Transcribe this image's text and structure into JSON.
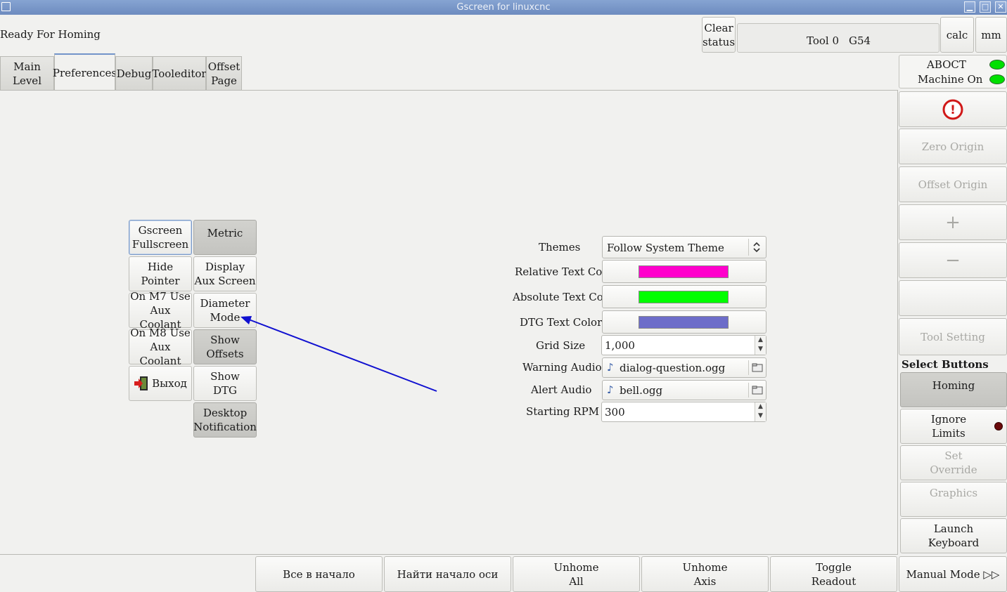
{
  "window": {
    "title": "Gscreen for linuxcnc",
    "min": "▁",
    "max": "□",
    "close": "✕"
  },
  "status": {
    "message": "Ready For Homing",
    "clear_label": "Clear\nstatus",
    "tool": "Tool 0",
    "coord": "G54",
    "calc_label": "calc",
    "units_label": "mm",
    "abort_label": "ABOCT",
    "machine_on_label": "Machine On",
    "led_color": "#00e000"
  },
  "tabs": [
    "Main Level",
    "Preferences",
    "Debug",
    "Tooleditor",
    "Offset\nPage"
  ],
  "prefs_buttons": {
    "fullscreen": "Gscreen\nFullscreen",
    "metric": "Metric",
    "hide_pointer": "Hide Pointer",
    "display_aux": "Display\nAux Screen",
    "m7": "On M7 Use\nAux Coolant",
    "diameter": "Diameter\nMode",
    "m8": "On M8 Use\nAux Coolant",
    "show_offsets": "Show\nOffsets",
    "exit": "Выход",
    "show_dtg": "Show\nDTG",
    "desktop_notification": "Desktop\nNotification"
  },
  "settings": {
    "themes_label": "Themes",
    "theme_value": "Follow System Theme",
    "rel_color_label": "Relative Text Color",
    "rel_color": "#ff00cc",
    "abs_color_label": "Absolute Text Color",
    "abs_color": "#00ff00",
    "dtg_color_label": "DTG Text Color",
    "dtg_color": "#6d6dc9",
    "grid_label": "Grid Size",
    "grid_value": "1,000",
    "warning_label": "Warning Audio",
    "warning_file": "dialog-question.ogg",
    "alert_label": "Alert Audio",
    "alert_file": "bell.ogg",
    "rpm_label": "Starting RPM",
    "rpm_value": "300"
  },
  "right_panel": {
    "estop_icon": "!",
    "zero_origin": "Zero Origin",
    "offset_origin": "Offset Origin",
    "plus": "+",
    "minus": "−",
    "tool_setting": "Tool Setting",
    "select_buttons": "Select Buttons",
    "homing": "Homing",
    "ignore_limits": "Ignore\nLimits",
    "set_override": "Set\nOverride",
    "graphics": "Graphics",
    "launch_keyboard": "Launch\nKeyboard",
    "manual_mode": "Manual Mode ▷▷"
  },
  "bottom_bar": {
    "home_all": "Все в начало",
    "home_axis": "Найти начало оси",
    "unhome_all": "Unhome\nAll",
    "unhome_axis": "Unhome\nAxis",
    "toggle_readout": "Toggle\nReadout"
  },
  "annotation_arrow_color": "#1010d0"
}
